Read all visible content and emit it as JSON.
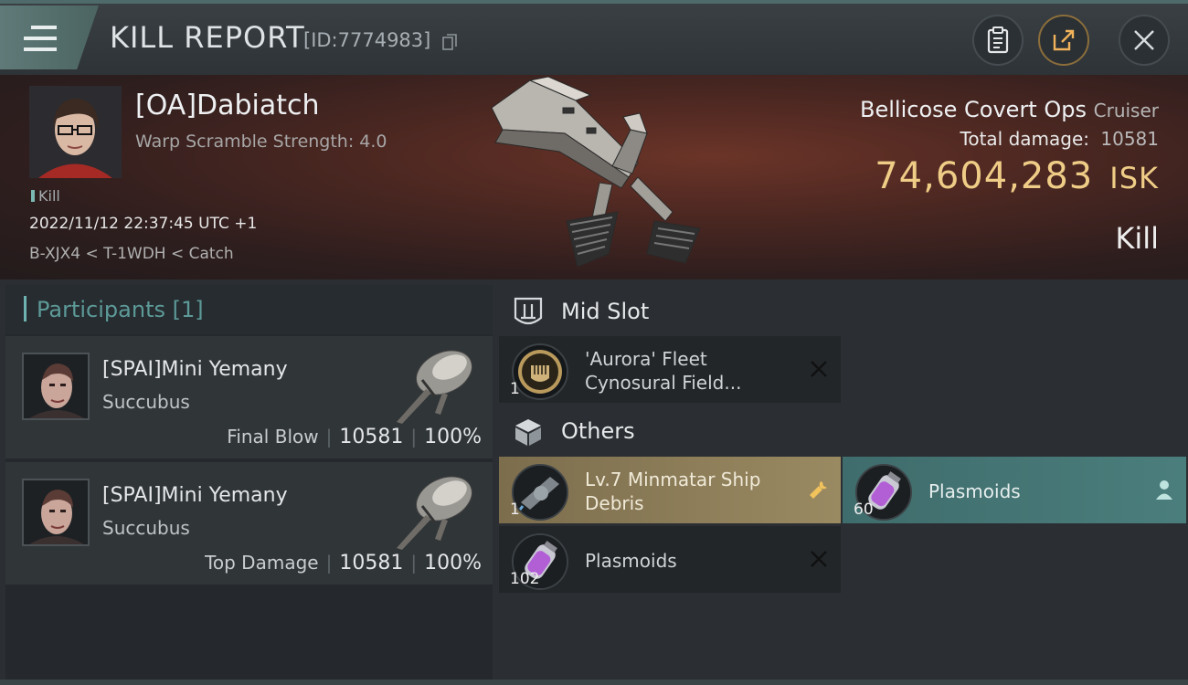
{
  "header": {
    "title": "KILL REPORT",
    "id_text": "[ID:7774983]",
    "icons": [
      "menu-icon",
      "copy-icon",
      "clipboard-icon",
      "share-icon",
      "close-icon"
    ]
  },
  "victim": {
    "name": "[OA]Dabiatch",
    "subtitle": "Warp Scramble Strength: 4.0",
    "tag": "Kill",
    "timestamp": "2022/11/12 22:37:45 UTC +1",
    "location": "B-XJX4 < T-1WDH < Catch",
    "ship_name": "Bellicose Covert Ops",
    "ship_class": "Cruiser",
    "total_damage_label": "Total damage:",
    "total_damage_value": "10581",
    "isk_value": "74,604,283",
    "isk_unit": "ISK",
    "result": "Kill"
  },
  "participants": {
    "heading": "Participants [1]",
    "items": [
      {
        "name": "[SPAI]Mini Yemany",
        "ship": "Succubus",
        "role": "Final Blow",
        "damage": "10581",
        "percent": "100%"
      },
      {
        "name": "[SPAI]Mini Yemany",
        "ship": "Succubus",
        "role": "Top Damage",
        "damage": "10581",
        "percent": "100%"
      }
    ]
  },
  "mid_slot": {
    "heading": "Mid Slot",
    "items": [
      {
        "name_line1": "'Aurora' Fleet",
        "name_line2": "Cynosural Field...",
        "qty": "1",
        "status_icon": "destroyed-x-icon"
      }
    ]
  },
  "others": {
    "heading": "Others",
    "items": [
      {
        "name_line1": "Lv.7 Minmatar Ship",
        "name_line2": "Debris",
        "qty": "1",
        "status_icon": "wrench-icon",
        "style": "dropped-gold"
      },
      {
        "name_line1": "Plasmoids",
        "name_line2": "",
        "qty": "60",
        "status_icon": "person-icon",
        "style": "dropped-teal"
      },
      {
        "name_line1": "Plasmoids",
        "name_line2": "",
        "qty": "102",
        "status_icon": "destroyed-x-icon",
        "style": "destroyed"
      }
    ]
  },
  "colors": {
    "accent_teal": "#6fb3b0",
    "isk_gold": "#efcd87",
    "dropped_gold": "#9a8a62",
    "dropped_teal": "#4a7e7c"
  }
}
